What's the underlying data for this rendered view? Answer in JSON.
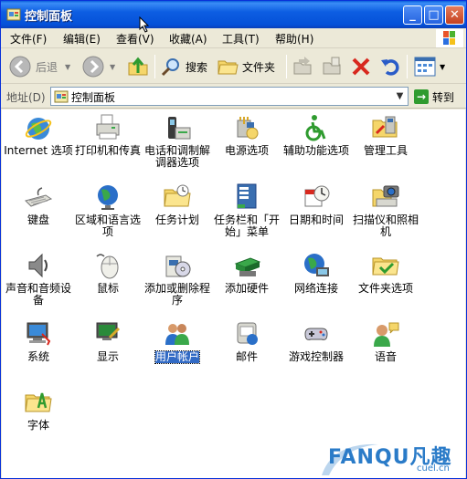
{
  "window": {
    "title": "控制面板"
  },
  "menu": [
    {
      "label": "文件(F)"
    },
    {
      "label": "编辑(E)"
    },
    {
      "label": "查看(V)"
    },
    {
      "label": "收藏(A)"
    },
    {
      "label": "工具(T)"
    },
    {
      "label": "帮助(H)"
    }
  ],
  "toolbar": {
    "back_label": "后退",
    "search_label": "搜索",
    "folders_label": "文件夹"
  },
  "address": {
    "label": "地址(D)",
    "value": "控制面板",
    "go_label": "转到"
  },
  "items": [
    {
      "label": "Internet 选项",
      "icon": "internet-options-icon"
    },
    {
      "label": "打印机和传真",
      "icon": "printer-fax-icon"
    },
    {
      "label": "电话和调制解调器选项",
      "icon": "phone-modem-icon"
    },
    {
      "label": "电源选项",
      "icon": "power-options-icon"
    },
    {
      "label": "辅助功能选项",
      "icon": "accessibility-icon"
    },
    {
      "label": "管理工具",
      "icon": "admin-tools-icon"
    },
    {
      "label": "键盘",
      "icon": "keyboard-icon"
    },
    {
      "label": "区域和语言选项",
      "icon": "globe-icon"
    },
    {
      "label": "任务计划",
      "icon": "scheduled-tasks-icon"
    },
    {
      "label": "任务栏和「开始」菜单",
      "icon": "taskbar-start-icon"
    },
    {
      "label": "日期和时间",
      "icon": "date-time-icon"
    },
    {
      "label": "扫描仪和照相机",
      "icon": "scanner-camera-icon"
    },
    {
      "label": "声音和音频设备",
      "icon": "speaker-icon"
    },
    {
      "label": "鼠标",
      "icon": "mouse-icon"
    },
    {
      "label": "添加或删除程序",
      "icon": "add-remove-programs-icon"
    },
    {
      "label": "添加硬件",
      "icon": "add-hardware-icon"
    },
    {
      "label": "网络连接",
      "icon": "network-connections-icon"
    },
    {
      "label": "文件夹选项",
      "icon": "folder-options-icon"
    },
    {
      "label": "系统",
      "icon": "system-icon"
    },
    {
      "label": "显示",
      "icon": "display-icon"
    },
    {
      "label": "用户帐户",
      "icon": "user-accounts-icon",
      "selected": true
    },
    {
      "label": "邮件",
      "icon": "mail-icon"
    },
    {
      "label": "游戏控制器",
      "icon": "game-controller-icon"
    },
    {
      "label": "语音",
      "icon": "speech-icon"
    },
    {
      "label": "字体",
      "icon": "fonts-folder-icon"
    }
  ],
  "watermark": {
    "text": "FANQU凡趣",
    "sub": "cuel.cn"
  },
  "colors": {
    "titlebar": "#0550d8",
    "selection": "#316ac5",
    "window_bg": "#ece9d8"
  }
}
